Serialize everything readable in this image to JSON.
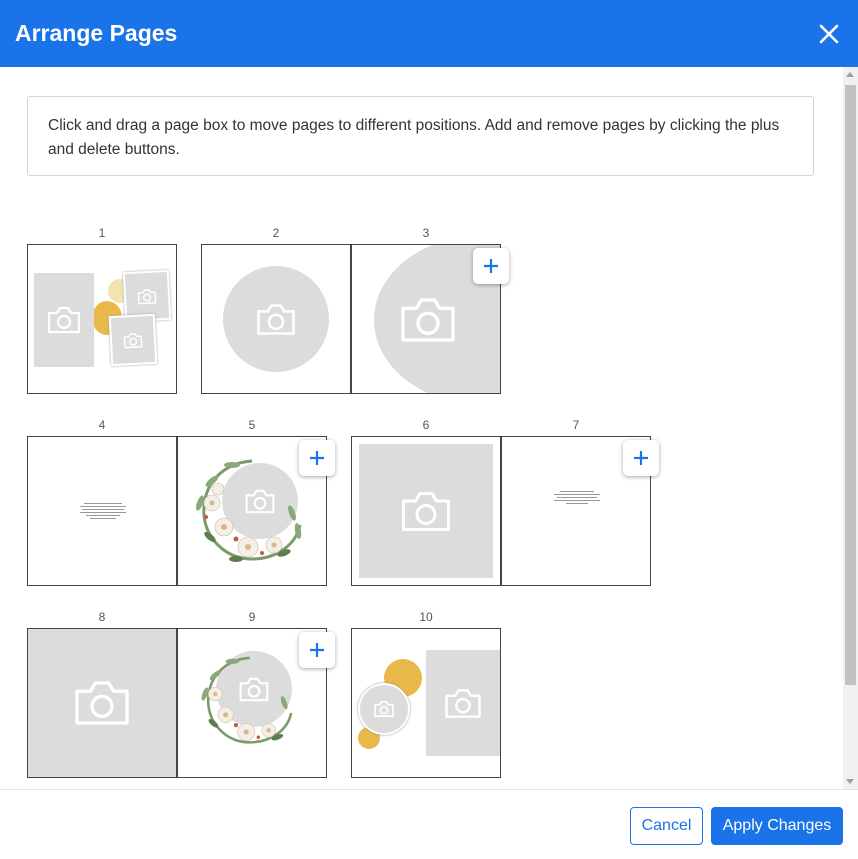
{
  "dialog": {
    "title": "Arrange Pages",
    "instructions": "Click and drag a page box to move pages to different positions. Add and remove pages by clicking the plus and delete buttons."
  },
  "pages": [
    {
      "number": "1"
    },
    {
      "number": "2"
    },
    {
      "number": "3"
    },
    {
      "number": "4"
    },
    {
      "number": "5"
    },
    {
      "number": "6"
    },
    {
      "number": "7"
    },
    {
      "number": "8"
    },
    {
      "number": "9"
    },
    {
      "number": "10"
    }
  ],
  "icons": {
    "close": "close-icon",
    "add": "plus-icon",
    "placeholder": "camera-icon"
  },
  "footer": {
    "cancel_label": "Cancel",
    "apply_label": "Apply Changes"
  },
  "colors": {
    "primary": "#1a73e8",
    "placeholder": "#dcdcdc",
    "accent_yellow": "#e8b84a"
  }
}
